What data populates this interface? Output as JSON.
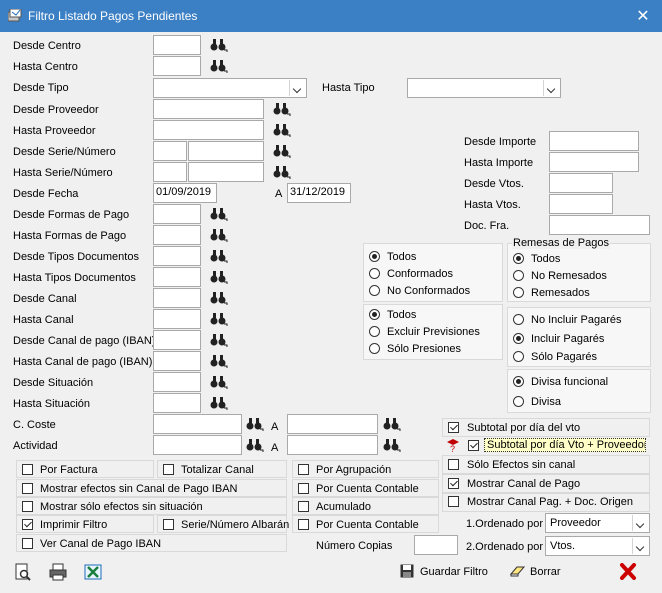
{
  "window": {
    "title": "Filtro Listado Pagos Pendientes"
  },
  "fields": {
    "desde_centro": "Desde Centro",
    "hasta_centro": "Hasta Centro",
    "desde_tipo": "Desde Tipo",
    "hasta_tipo": "Hasta Tipo",
    "desde_proveedor": "Desde Proveedor",
    "hasta_proveedor": "Hasta Proveedor",
    "desde_serie": "Desde Serie/Número",
    "hasta_serie": "Hasta Serie/Número",
    "desde_fecha": "Desde Fecha",
    "fecha_a": "A",
    "desde_fecha_value": "01/09/2019",
    "hasta_fecha_value": "31/12/2019",
    "desde_formas": "Desde Formas de Pago",
    "hasta_formas": "Hasta Formas de Pago",
    "desde_tipos_doc": "Desde Tipos Documentos",
    "hasta_tipos_doc": "Hasta Tipos Documentos",
    "desde_canal": "Desde Canal",
    "hasta_canal": "Hasta Canal",
    "desde_canal_iban": "Desde Canal de pago (IBAN)",
    "hasta_canal_iban": "Hasta Canal de pago (IBAN)",
    "desde_situacion": "Desde Situación",
    "hasta_situacion": "Hasta Situación",
    "c_coste": "C. Coste",
    "actividad": "Actividad",
    "a1": "A",
    "a2": "A",
    "desde_importe": "Desde Importe",
    "hasta_importe": "Hasta Importe",
    "desde_vtos": "Desde Vtos.",
    "hasta_vtos": "Hasta Vtos.",
    "doc_fra": "Doc. Fra."
  },
  "radios": {
    "conf": [
      "Todos",
      "Conformados",
      "No Conformados"
    ],
    "remesas_title": "Remesas de Pagos",
    "remesas": [
      "Todos",
      "No Remesados",
      "Remesados"
    ],
    "prev": [
      "Todos",
      "Excluir Previsiones",
      "Sólo Presiones"
    ],
    "pagares": [
      "No Incluir Pagarés",
      "Incluir Pagarés",
      "Sólo Pagarés"
    ],
    "divisa": [
      "Divisa funcional",
      "Divisa"
    ]
  },
  "checks": {
    "por_factura": "Por Factura",
    "totalizar_canal": "Totalizar Canal",
    "por_agrupacion": "Por Agrupación",
    "mostrar_sin_canal": "Mostrar efectos sin Canal de Pago IBAN",
    "por_cuenta1": "Por Cuenta Contable",
    "mostrar_sin_situacion": "Mostrar sólo efectos sin situación",
    "acumulado": "Acumulado",
    "imprimir_filtro": "Imprimir Filtro",
    "serie_albaran": "Serie/Número Albarán",
    "por_cuenta2": "Por Cuenta Contable",
    "ver_canal": "Ver Canal de Pago IBAN",
    "subtotal_dia": "Subtotal por día del vto",
    "subtotal_dia_prov": "Subtotal por día Vto + Proveedor",
    "solo_efectos": "Sólo Efectos sin canal",
    "mostrar_canal": "Mostrar Canal de Pago",
    "mostrar_canal_doc": "Mostrar Canal Pag. + Doc. Origen"
  },
  "copias": {
    "label": "Número Copias",
    "value": ""
  },
  "orden": {
    "label1": "1.Ordenado por",
    "value1": "Proveedor",
    "label2": "2.Ordenado por",
    "value2": "Vtos."
  },
  "toolbar": {
    "guardar": "Guardar Filtro",
    "borrar": "Borrar"
  },
  "colors": {
    "titlebar": "#3b7fc4",
    "highlight": "#ffffc8",
    "close_red": "#cc0000"
  }
}
